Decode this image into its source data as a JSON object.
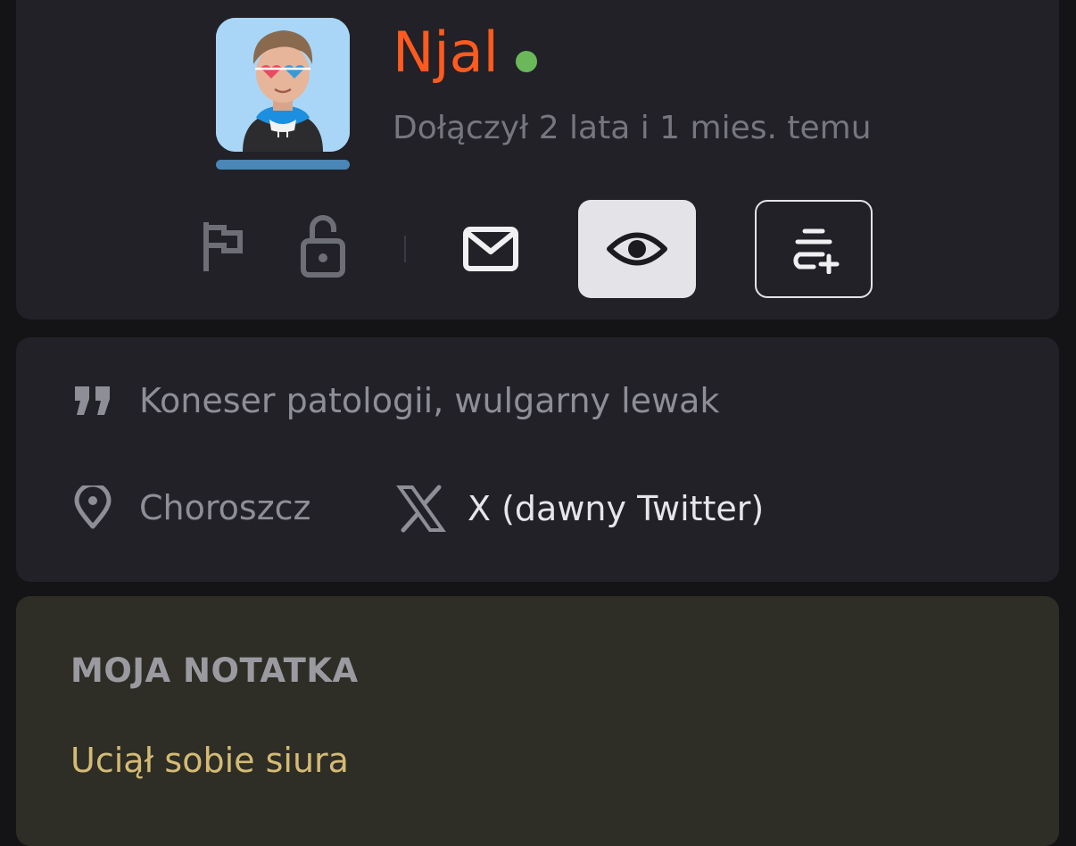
{
  "profile": {
    "username": "Njal",
    "online": true,
    "joined_text": "Dołączył 2 lata i 1 mies. temu",
    "avatar_icon": "memoji-avatar",
    "colors": {
      "username": "#ff5a1f",
      "online_dot": "#6ab85a",
      "avatar_bar": "#4a86b6"
    }
  },
  "actions": [
    {
      "name": "report",
      "icon": "flag-icon"
    },
    {
      "name": "block",
      "icon": "unlocked-padlock-icon"
    },
    {
      "name": "message",
      "icon": "envelope-icon"
    },
    {
      "name": "observe",
      "icon": "eye-icon",
      "active": true
    },
    {
      "name": "blacklist",
      "icon": "stack-plus-icon"
    }
  ],
  "info": {
    "description": "Koneser patologii, wulgarny lewak",
    "description_icon": "quote-icon",
    "location": "Choroszcz",
    "location_icon": "map-pin-icon",
    "social_label": "X (dawny Twitter)",
    "social_icon": "x-logo-icon"
  },
  "note": {
    "heading": "MOJA NOTATKA",
    "text": "Uciął sobie siura",
    "colors": {
      "background": "#2e2e26",
      "text": "#d4bb74"
    }
  }
}
